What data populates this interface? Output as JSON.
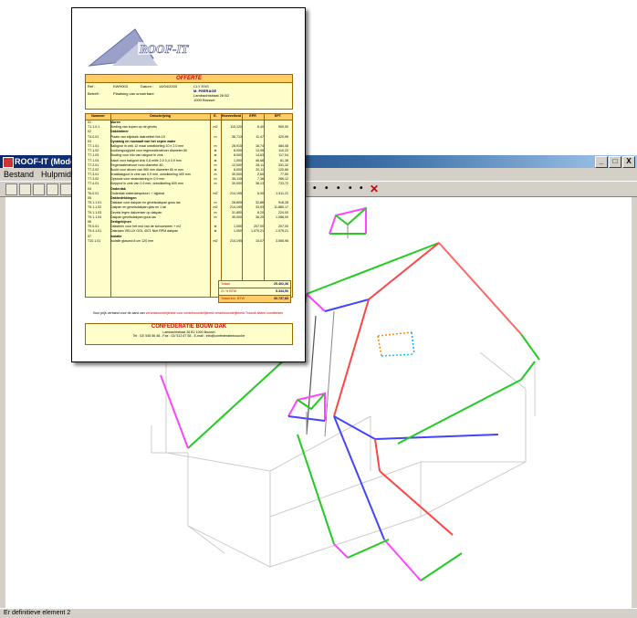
{
  "window": {
    "title": "ROOF-IT (Mode m",
    "controls": [
      "_",
      "□",
      "X"
    ]
  },
  "menu": [
    "Bestand",
    "Hulpmiddelen"
  ],
  "statusbar": {
    "text": "Er definitieve element 2"
  },
  "toolbar": {
    "nav_arrows": [
      "•",
      "•",
      "•",
      "•",
      "•"
    ],
    "close_label": "✕"
  },
  "document": {
    "logo_text": "ROOF-IT",
    "heading": "OFFERTE",
    "ref_label": "Ref :",
    "ref_value": "KWH003",
    "datum_label": "Datum :",
    "datum_value": "14/04/2003",
    "betreft_label": "Betreft :",
    "betreft_value": "Plaatsing van onroerbare",
    "client": [
      "CLY ENS",
      "M. PEERAGE",
      "Lambachtstraat 26 B2",
      "1000        Brussel"
    ],
    "columns": [
      "Nummer",
      "Omschrijving",
      "E.",
      "Hoeveelheid",
      "EPR",
      "EPT"
    ],
    "rows": [
      {
        "num": "01",
        "desc": "Muren",
        "e": "",
        "q": "",
        "epr": "",
        "ept": "",
        "group": true
      },
      {
        "num": "T1.1.0.1",
        "desc": "Kleding van kopen op de gevels",
        "e": "m2",
        "q": "110,120",
        "epr": "8,40",
        "ept": "960,00",
        "group": false
      },
      {
        "num": "02",
        "desc": "Dakbintmer",
        "e": "",
        "q": "",
        "epr": "",
        "ept": "",
        "group": true
      },
      {
        "num": "T4.0.01",
        "desc": "Plaats van stijnbalk dakroeibel link 15",
        "e": "m",
        "q": "36,713",
        "epr": "11,47",
        "ept": "420,95",
        "group": false
      },
      {
        "num": "03",
        "desc": "Dynamig en rouwaalt van het sepen water",
        "e": "",
        "q": "",
        "epr": "",
        "ept": "",
        "group": true
      },
      {
        "num": "T7.1.01",
        "desc": "Balkgoot in zink 12 maal ontwikkeling 10 x 2,0 mm",
        "e": "m",
        "q": "28,915",
        "epr": "16,74",
        "ept": "484,08",
        "group": false
      },
      {
        "num": "T7.1.02",
        "desc": "Kooikergoog/piet voor regenwaterafvoer diameter 80",
        "e": "st",
        "q": "8,000",
        "epr": "13,95",
        "ept": "110,22",
        "group": false
      },
      {
        "num": "T7.1.03",
        "desc": "Stoding voor kilo van rakgoot in zink",
        "e": "st",
        "q": "8,000",
        "epr": "14,63",
        "ept": "117,04",
        "group": false
      },
      {
        "num": "T7.1.04",
        "desc": "Kakel voor bakgoot zink 0,8 mitle 2,0 0,4 0,9 mm",
        "e": "st",
        "q": "1,000",
        "epr": "46,68",
        "ept": "81,38",
        "group": false
      },
      {
        "num": "T7.2.01",
        "desc": "Regenwaterafvoer rond diameter 80",
        "e": "m",
        "q": "12,000",
        "epr": "28,11",
        "ept": "331,32",
        "group": false
      },
      {
        "num": "T7.2.02",
        "desc": "Bocht voor afvoer van 960 mm diameter 80 m mm",
        "e": "st",
        "q": "8,000",
        "epr": "20,11",
        "ept": "120,66",
        "group": false
      },
      {
        "num": "T7.3.01",
        "desc": "Kraaldakgoot in zink van 0,9 mm, ontwikkeling 400 mm",
        "e": "m",
        "q": "30,000",
        "epr": "2,60",
        "ept": "77,50",
        "group": false
      },
      {
        "num": "T7.3.02",
        "desc": "Opstook voor strakvisering in 0,9 mm",
        "e": "m",
        "q": "36,115",
        "epr": "7,36",
        "ept": "266,12",
        "group": false
      },
      {
        "num": "T7.4.01",
        "desc": "Kiepprof in zink van 0,9 mm, ontwikkeling 600 mm",
        "e": "m",
        "q": "30,000",
        "epr": "36,13",
        "ept": "733,72",
        "group": false
      },
      {
        "num": "04",
        "desc": "Onderdak",
        "e": "",
        "q": "",
        "epr": "",
        "ept": "",
        "group": true
      },
      {
        "num": "T6.0.01",
        "desc": "Onderdak waterdampdoorl. + bijpleat",
        "e": "m2",
        "q": "214,195",
        "epr": "6,00",
        "ept": "1.511,21",
        "group": false
      },
      {
        "num": "05",
        "desc": "Dakbedekkingen",
        "e": "",
        "q": "",
        "epr": "",
        "ept": "",
        "group": true
      },
      {
        "num": "T9.1.1.01",
        "desc": "Daklaan voor dakpan en gevelsdakpan gous las",
        "e": "m",
        "q": "28,805",
        "epr": "32,86",
        "ept": "918,28",
        "group": false
      },
      {
        "num": "T9.1.1.02",
        "desc": "Dakpan en gevelsdakpan glas en 1 tal",
        "e": "m2",
        "q": "214,195",
        "epr": "33,93",
        "ept": "11.880,17",
        "group": false
      },
      {
        "num": "T9.1.1.03",
        "desc": "Gevels legen dakvenser op dakpan",
        "e": "m",
        "q": "31,800",
        "epr": "8,20",
        "ept": "224,00",
        "group": false
      },
      {
        "num": "T9.1.1.04",
        "desc": "Dakpan gevelsdakpan gous las",
        "e": "m",
        "q": "30,000",
        "epr": "36,20",
        "ept": "1.086,00",
        "group": false
      },
      {
        "num": "06",
        "desc": "Gedigehijnen",
        "e": "",
        "q": "",
        "epr": "",
        "ept": "",
        "group": true
      },
      {
        "num": "T9.0.01",
        "desc": "Daksteen voor het mst van de schoorsteen + m2",
        "e": "st",
        "q": "1,000",
        "epr": "207,00",
        "ept": "207,00",
        "group": false
      },
      {
        "num": "T9.4.1.01",
        "desc": "Dakraam VELUX GGL 4071 Niet RPM dakpan",
        "e": "st",
        "q": "1,000",
        "epr": "1.079,21",
        "ept": "1.079,21",
        "group": false
      },
      {
        "num": "07",
        "desc": "Isolatie",
        "e": "",
        "q": "",
        "epr": "",
        "ept": "",
        "group": true
      },
      {
        "num": "T10.1.01",
        "desc": "Isolatie glaswol 8 cm 120 mm",
        "e": "m2",
        "q": "214,195",
        "epr": "15,07",
        "ept": "3.065,96",
        "group": false
      }
    ],
    "totals": [
      {
        "label": "Totaal",
        "value": "25.402,36"
      },
      {
        "label": "21 % BTW",
        "value": "5.334,50"
      },
      {
        "label": "Totaal incl. BTW",
        "value": "30.737,83"
      }
    ],
    "note_prefix": "Voor prijs verband voor de aard van",
    "note_red": "verantwoordelijkheid voor verantwoordelijkheid verantwoordelijkheid Trouwk alsten conditiesen",
    "footer_name": "CONFEDERATIE BOUW DAK",
    "footer_lines": [
      "Lambachtstraat 26 B2 1000 Brussel",
      "Tel : 02/ 545 56 48  -  Fax : 02/ 513 67 58  -  E-mail : info@confederatiebouw.be"
    ]
  },
  "colors": {
    "title_bar": "#0a246a",
    "chrome": "#d4d0c8",
    "doc_fill": "#ffffcc",
    "doc_header": "#ffcc66",
    "accent_red": "#cc0000"
  }
}
